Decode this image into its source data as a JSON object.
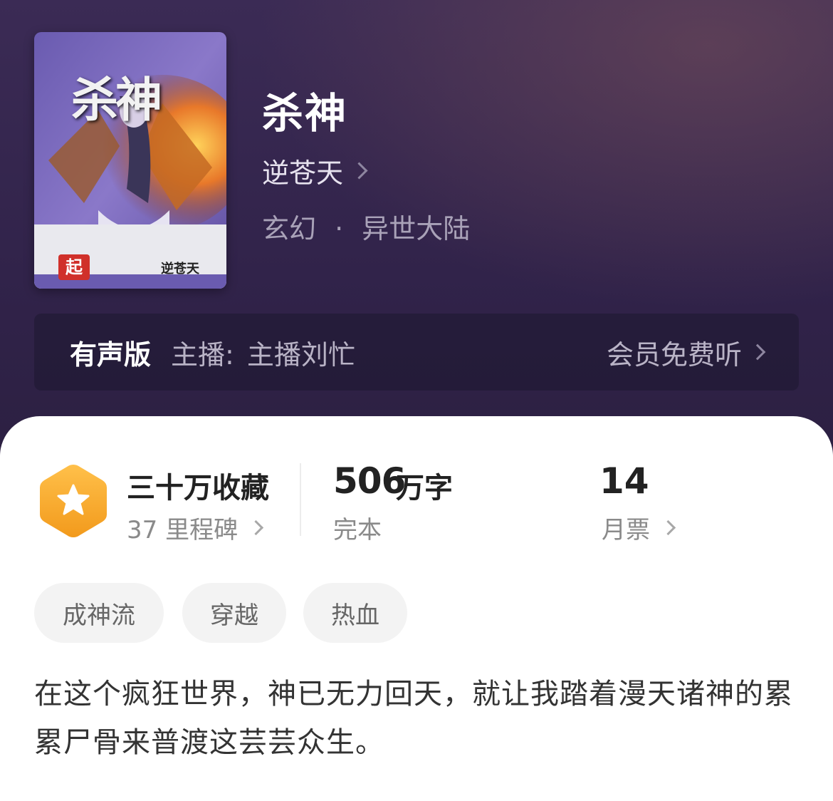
{
  "book": {
    "title": "杀神",
    "author": "逆苍天",
    "genre": "玄幻",
    "separator": "·",
    "subgenre": "异世大陆",
    "cover": {
      "title_text": "杀神",
      "author_text": "逆苍天",
      "logo_text": "起"
    }
  },
  "audio": {
    "label": "有声版",
    "host_label": "主播:",
    "host_name": "主播刘忙",
    "cta": "会员免费听"
  },
  "stats": {
    "favorites": "三十万收藏",
    "milestones": "37 里程碑",
    "word_count": "506",
    "word_unit": "万字",
    "status": "完本",
    "monthly_tickets": "14",
    "monthly_tickets_label": "月票"
  },
  "tags": [
    "成神流",
    "穿越",
    "热血"
  ],
  "description": "在这个疯狂世界，神已无力回天，就让我踏着漫天诸神的累累尸骨来普渡这芸芸众生。",
  "colors": {
    "header_bg": "#31234a",
    "badge_orange": "#f5a623",
    "card_bg": "#ffffff"
  }
}
